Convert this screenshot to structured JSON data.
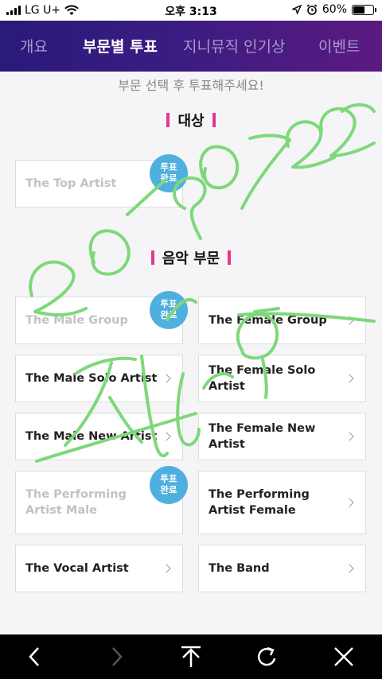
{
  "status": {
    "carrier": "LG U+",
    "time": "오후 3:13",
    "battery": "60%",
    "battery_level": 0.6
  },
  "tabs": [
    {
      "label": "개요",
      "active": false
    },
    {
      "label": "부문별 투표",
      "active": true
    },
    {
      "label": "지니뮤직 인기상",
      "active": false
    },
    {
      "label": "이벤트",
      "active": false
    }
  ],
  "intro": "부문 선택 후 투표해주세요!",
  "sections": {
    "grand": {
      "title": "대상"
    },
    "music": {
      "title": "음악 부문"
    }
  },
  "cards": {
    "top_artist": {
      "label": "The Top Artist",
      "voted": true
    },
    "male_group": {
      "label": "The Male Group",
      "voted": true
    },
    "female_group": {
      "label": "The Female Group",
      "voted": false
    },
    "male_solo": {
      "label": "The Male Solo Artist",
      "voted": false
    },
    "female_solo": {
      "label": "The Female Solo Artist",
      "voted": false
    },
    "male_new": {
      "label": "The Male New Artist",
      "voted": false
    },
    "female_new": {
      "label": "The Female New Artist",
      "voted": false
    },
    "performing_male": {
      "line1": "The Performing",
      "line2": "Artist Male",
      "voted": true
    },
    "performing_female": {
      "line1": "The Performing",
      "line2": "Artist Female",
      "voted": false
    },
    "vocal": {
      "label": "The Vocal Artist",
      "voted": false
    },
    "band": {
      "label": "The Band",
      "voted": false
    }
  },
  "badge": {
    "line1": "투표",
    "line2": "완료"
  },
  "icons": {
    "back": "chevron-left-icon",
    "forward": "chevron-right-icon",
    "top": "arrow-up-icon",
    "reload": "reload-icon",
    "close": "close-icon"
  },
  "colors": {
    "header_start": "#2a1a7a",
    "header_end": "#5b1a80",
    "accent_pink": "#e5358f",
    "badge_blue": "#4fb0e0",
    "handwriting_green": "#7ed87a"
  }
}
